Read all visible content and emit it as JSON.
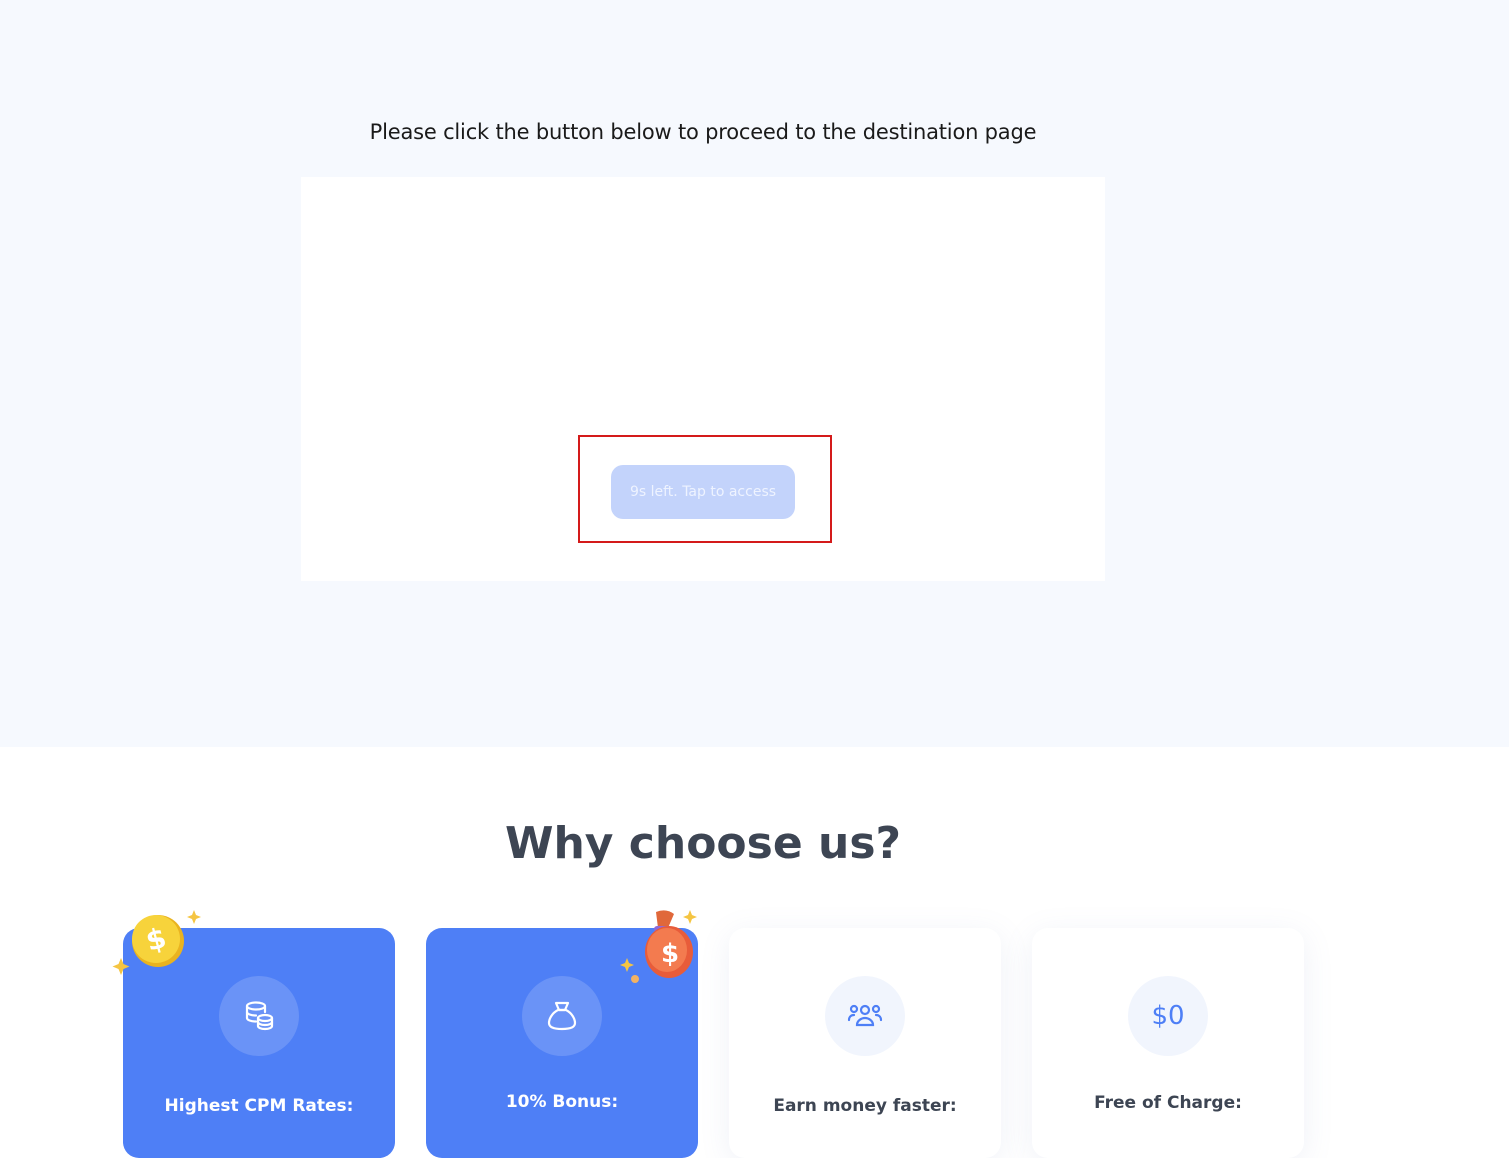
{
  "page": {
    "instruction": "Please click the button below to proceed to the destination page",
    "access_button_label": "9s left. Tap to access"
  },
  "why": {
    "heading": "Why choose us?",
    "cards": [
      {
        "title": "Highest CPM Rates:",
        "icon": "coins-stack-icon",
        "style": "blue"
      },
      {
        "title": "10% Bonus:",
        "icon": "money-bag-icon",
        "style": "blue"
      },
      {
        "title": "Earn money faster:",
        "icon": "users-group-icon",
        "style": "white"
      },
      {
        "title": "Free of Charge:",
        "icon_text": "$0",
        "style": "white"
      }
    ]
  },
  "colors": {
    "accent": "#4e7ff6",
    "button_disabled": "#c3d3fb",
    "highlight_border": "#d41a1a",
    "background_light": "#f6f9fe"
  }
}
